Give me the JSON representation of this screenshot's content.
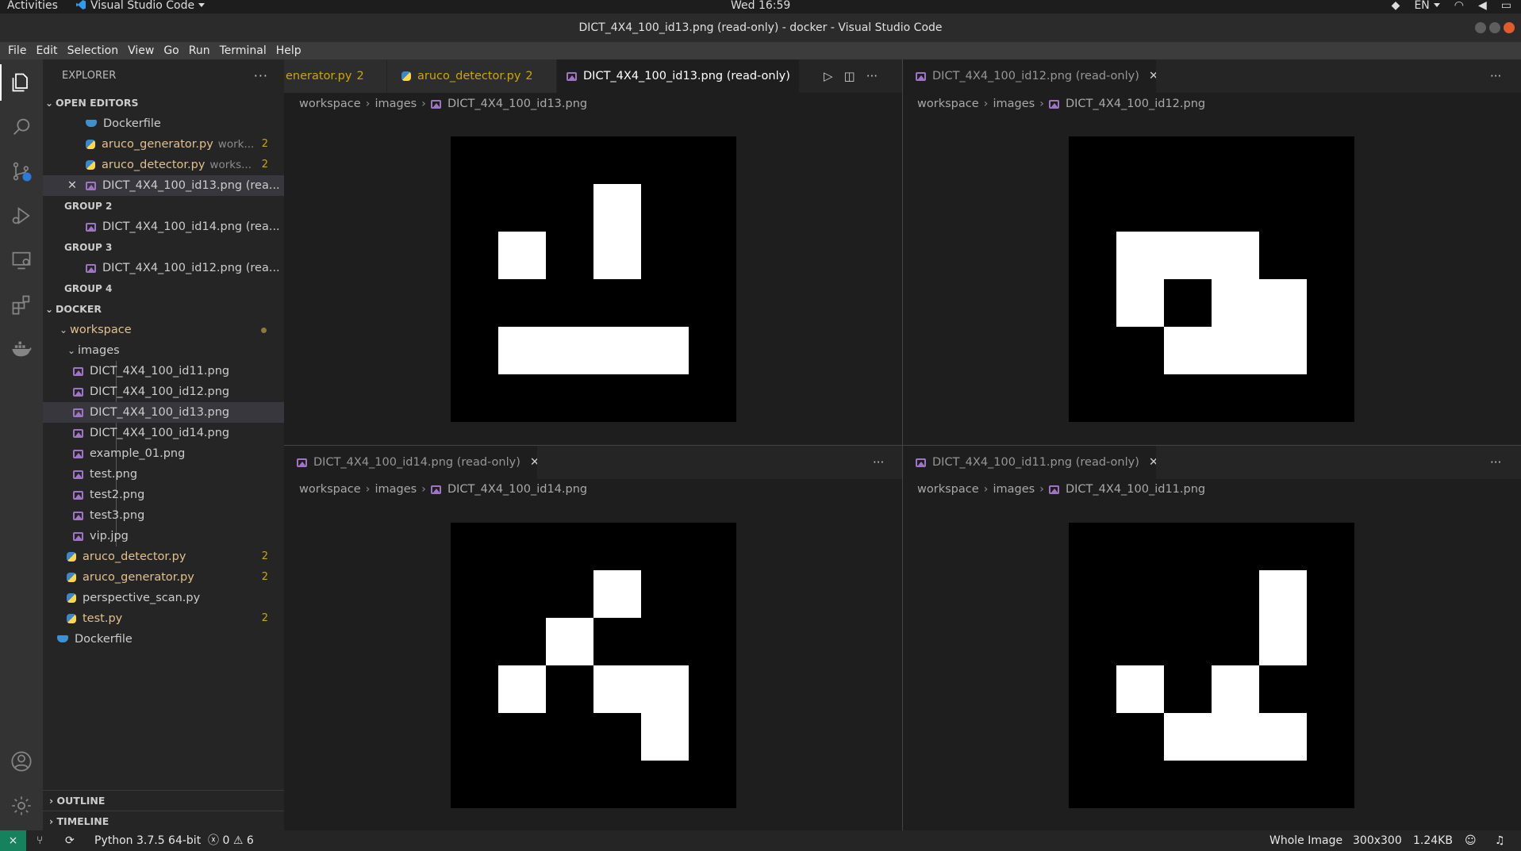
{
  "topbar": {
    "activities": "Activities",
    "app_name": "Visual Studio Code",
    "clock": "Wed 16:59",
    "language": "EN"
  },
  "window": {
    "title": "DICT_4X4_100_id13.png (read-only) - docker - Visual Studio Code"
  },
  "menu": [
    "File",
    "Edit",
    "Selection",
    "View",
    "Go",
    "Run",
    "Terminal",
    "Help"
  ],
  "sidebar": {
    "title": "EXPLORER",
    "open_editors_label": "OPEN EDITORS",
    "open_editors": [
      {
        "name": "Dockerfile",
        "desc": "",
        "badge": ""
      },
      {
        "name": "aruco_generator.py",
        "desc": "work...",
        "badge": "2"
      },
      {
        "name": "aruco_detector.py",
        "desc": "works...",
        "badge": "2"
      },
      {
        "name": "DICT_4X4_100_id13.png (rea...",
        "desc": "",
        "badge": ""
      }
    ],
    "group2_label": "GROUP 2",
    "group2_file": "DICT_4X4_100_id14.png (rea...",
    "group3_label": "GROUP 3",
    "group3_file": "DICT_4X4_100_id12.png (rea...",
    "group4_label": "GROUP 4",
    "docker_label": "DOCKER",
    "workspace_label": "workspace",
    "images_label": "images",
    "image_files": [
      "DICT_4X4_100_id11.png",
      "DICT_4X4_100_id12.png",
      "DICT_4X4_100_id13.png",
      "DICT_4X4_100_id14.png",
      "example_01.png",
      "test.png",
      "test2.png",
      "test3.png",
      "vip.jpg"
    ],
    "workspace_files": [
      {
        "name": "aruco_detector.py",
        "badge": "2"
      },
      {
        "name": "aruco_generator.py",
        "badge": "2"
      },
      {
        "name": "perspective_scan.py",
        "badge": ""
      },
      {
        "name": "test.py",
        "badge": "2"
      }
    ],
    "dockerfile": "Dockerfile",
    "outline_label": "OUTLINE",
    "timeline_label": "TIMELINE"
  },
  "editors": {
    "group1_tabs": [
      {
        "label": "enerator.py",
        "badge": "2"
      },
      {
        "label": "aruco_detector.py",
        "badge": "2"
      },
      {
        "label": "DICT_4X4_100_id13.png (read-only)",
        "badge": ""
      }
    ],
    "group2_tab": "DICT_4X4_100_id12.png (read-only)",
    "group3_tab": "DICT_4X4_100_id14.png (read-only)",
    "group4_tab": "DICT_4X4_100_id11.png (read-only)",
    "breadcrumb_root": "workspace",
    "breadcrumb_folder": "images",
    "breadcrumb_id13": "DICT_4X4_100_id13.png",
    "breadcrumb_id12": "DICT_4X4_100_id12.png",
    "breadcrumb_id14": "DICT_4X4_100_id14.png",
    "breadcrumb_id11": "DICT_4X4_100_id11.png"
  },
  "markers": {
    "id13": [
      [
        0,
        0,
        0,
        0
      ],
      [
        0,
        0,
        1,
        0
      ],
      [
        1,
        0,
        1,
        0
      ],
      [
        0,
        0,
        0,
        0
      ],
      [
        1,
        1,
        1,
        1
      ]
    ],
    "id12": [
      [
        0,
        0,
        0,
        0
      ],
      [
        0,
        0,
        0,
        0
      ],
      [
        1,
        1,
        1,
        0
      ],
      [
        1,
        0,
        1,
        1
      ],
      [
        0,
        1,
        1,
        1
      ]
    ],
    "id14": [
      [
        0,
        0,
        0,
        0
      ],
      [
        0,
        0,
        1,
        0
      ],
      [
        0,
        1,
        0,
        0
      ],
      [
        1,
        0,
        1,
        1
      ],
      [
        0,
        0,
        0,
        1
      ]
    ],
    "id11": [
      [
        0,
        0,
        0,
        0
      ],
      [
        0,
        0,
        0,
        1
      ],
      [
        0,
        0,
        0,
        1
      ],
      [
        1,
        0,
        1,
        0
      ],
      [
        0,
        1,
        1,
        1
      ]
    ]
  },
  "statusbar": {
    "python": "Python 3.7.5 64-bit",
    "errors": "0",
    "warnings": "6",
    "zoom_mode": "Whole Image",
    "dimensions": "300x300",
    "file_size": "1.24KB"
  },
  "colors": {
    "accent_modified": "#cca700",
    "status_remote": "#16825d"
  }
}
